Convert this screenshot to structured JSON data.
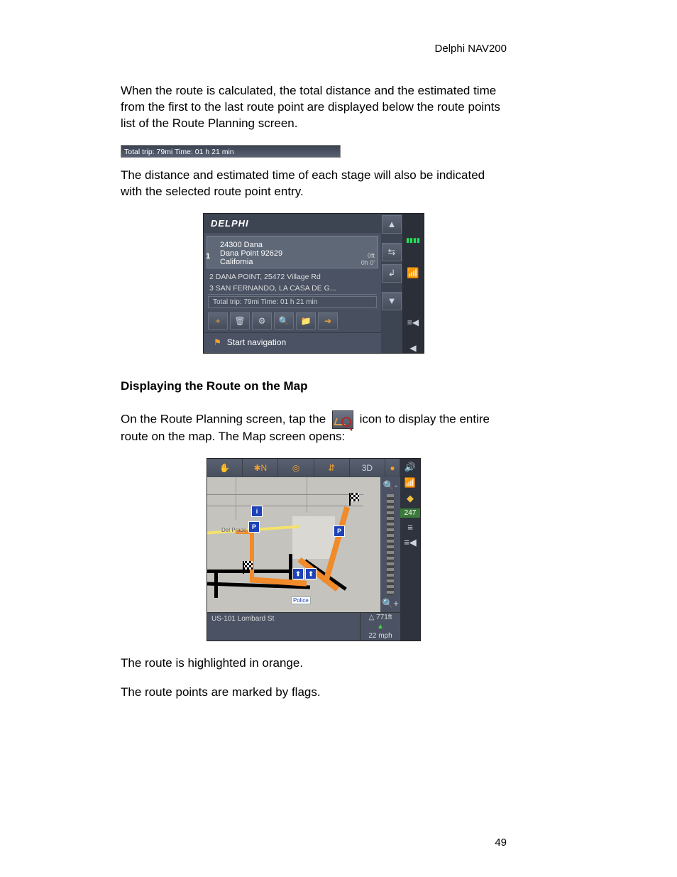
{
  "header": {
    "product": "Delphi NAV200"
  },
  "paragraphs": {
    "p1": "When the route is calculated, the total distance and the estimated time from the first to the last route point are displayed below the route points list of the Route Planning screen.",
    "p2": "The distance and estimated time of each stage will also be indicated with the selected route point entry.",
    "p3a": "On the Route Planning screen, tap the ",
    "p3b": " icon to display the entire route on the map. The Map screen opens:",
    "p4": "The route is highlighted in orange.",
    "p5": "The route points are marked by flags."
  },
  "subhead": "Displaying the Route on the Map",
  "trip_bar": "Total trip: 79mi Time: 01 h 21 min",
  "device1": {
    "logo": "DELPHI",
    "selected": {
      "num": "1",
      "line1": "24300 Dana",
      "line2": "Dana Point 92629",
      "line3": "California",
      "dist1": "0ft",
      "dist2": "0h 0'"
    },
    "rp2": "2 DANA POINT, 25472 Village Rd",
    "rp3": "3 SAN FERNANDO, LA CASA DE G...",
    "total": "Total trip: 79mi Time: 01 h 21 min",
    "startnav": "Start navigation",
    "icons": {
      "up": "▲",
      "down": "▼",
      "swap": "⇆",
      "return": "↲",
      "add": "+",
      "trash": "🗑",
      "calc": "⚙",
      "map": "🔍",
      "save": "📁",
      "go": "➔",
      "menu": "≡◀",
      "back": "◀",
      "flag": "⚑",
      "battery": "▮▮▮▮"
    }
  },
  "device2": {
    "top_icons": [
      "✋",
      "✱N",
      "◎",
      "⇵",
      "3D",
      "●"
    ],
    "right_icons": {
      "sound": "🔊",
      "zoom_out": "🔍-",
      "zoom_in": "🔍+"
    },
    "outer": {
      "sat": "📶",
      "compass": "◆",
      "num": "247",
      "opts": "≡",
      "menu": "≡◀"
    },
    "elev_label": "△  771ft",
    "up_arrow": "▲",
    "speed": "22 mph",
    "road": "US-101 Lombard St",
    "police": "Police",
    "delprado": "Del Prado",
    "poi_info": "i",
    "poi_park": "P",
    "poi_up": "⬆"
  },
  "page_number": "49"
}
